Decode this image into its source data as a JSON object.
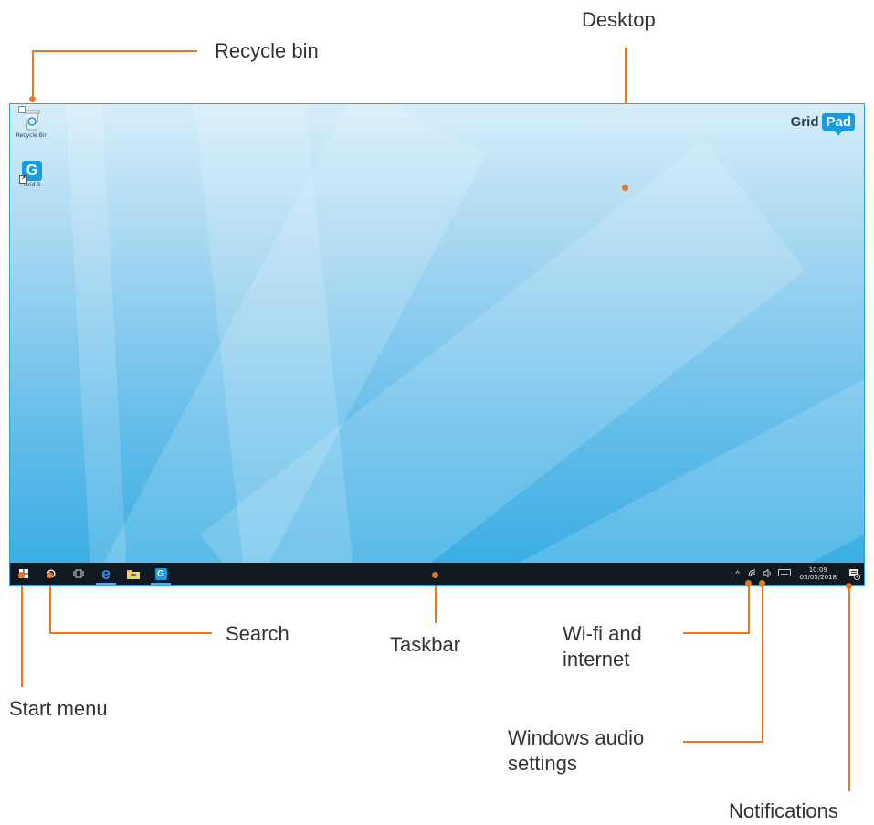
{
  "desktop": {
    "icons": [
      {
        "label": "Recycle Bin",
        "icon": "recycle-bin-icon"
      },
      {
        "label": "Grid 3",
        "icon": "grid-3-app-icon"
      }
    ],
    "logo": {
      "left": "Grid",
      "right": "Pad"
    }
  },
  "taskbar": {
    "buttons": [
      {
        "name": "start-button",
        "icon": "windows-logo-icon",
        "glyph": "⊞"
      },
      {
        "name": "search-button",
        "icon": "cortana-circle-icon",
        "glyph": "○"
      },
      {
        "name": "task-view-button",
        "icon": "task-view-icon",
        "glyph": "▯"
      },
      {
        "name": "edge-button",
        "icon": "edge-browser-icon",
        "glyph": "e"
      },
      {
        "name": "file-explorer-button",
        "icon": "folder-icon",
        "glyph": "▬"
      },
      {
        "name": "grid-3-taskbar-button",
        "icon": "grid-3-app-icon",
        "glyph": "G"
      }
    ],
    "tray": {
      "chevron": "^",
      "wifi": "wifi-icon",
      "volume": "speaker-icon",
      "keyboard": "keyboard-icon",
      "time": "10:09",
      "date": "03/05/2018",
      "notification_count": "1"
    }
  },
  "callouts": {
    "recycle_bin": "Recycle bin",
    "desktop": "Desktop",
    "search": "Search",
    "taskbar": "Taskbar",
    "wifi": "Wi-fi and internet",
    "start_menu": "Start menu",
    "audio": "Windows audio settings",
    "notifications": "Notifications"
  },
  "colors": {
    "callout_line": "#e87722",
    "frame": "#2aa0dc",
    "taskbar": "#101820",
    "accent": "#1a9be0"
  }
}
